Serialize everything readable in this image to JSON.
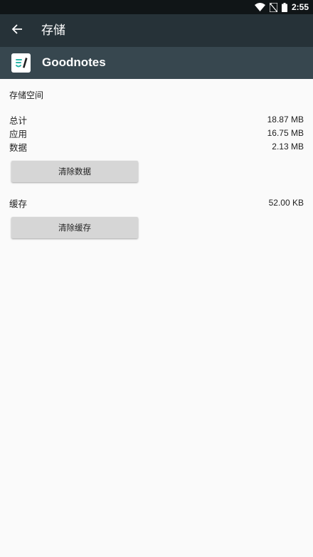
{
  "status_bar": {
    "time": "2:55",
    "icons": [
      "wifi-icon",
      "no-sim-icon",
      "battery-icon"
    ]
  },
  "app_bar": {
    "title": "存储",
    "back_icon": "arrow-back-icon"
  },
  "app_header": {
    "name": "Goodnotes",
    "icon": "goodnotes-app-icon",
    "icon_color": "#2bb5a9"
  },
  "storage": {
    "section_title": "存储空间",
    "rows": [
      {
        "label": "总计",
        "value": "18.87 MB"
      },
      {
        "label": "应用",
        "value": "16.75 MB"
      },
      {
        "label": "数据",
        "value": "2.13 MB"
      }
    ],
    "clear_data_label": "清除数据"
  },
  "cache": {
    "label": "缓存",
    "value": "52.00 KB",
    "clear_cache_label": "清除缓存"
  },
  "colors": {
    "status_bar": "#101517",
    "app_bar": "#263238",
    "app_header": "#37474f",
    "background": "#fafafa",
    "button": "#d6d6d6"
  }
}
